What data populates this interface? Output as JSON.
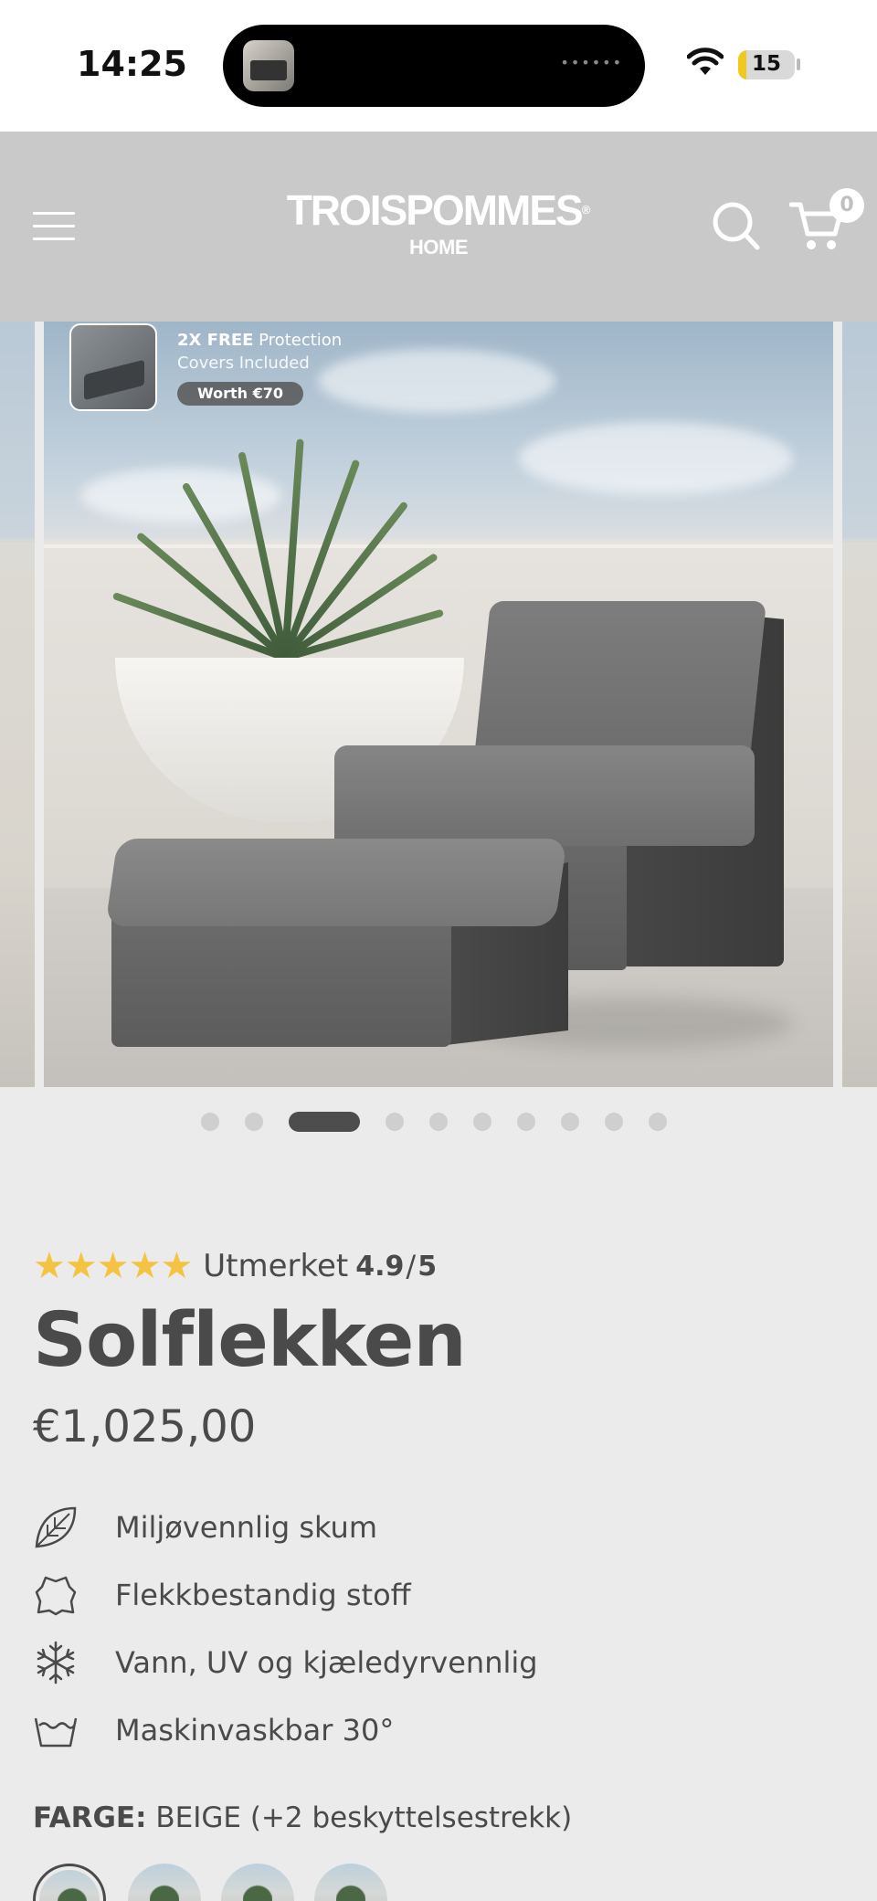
{
  "status_bar": {
    "time": "14:25",
    "battery": "15",
    "battery_fraction": 0.15,
    "battery_color": "#f2c81e"
  },
  "header": {
    "logo_main": "TROISPOMMES",
    "logo_registered": "®",
    "logo_sub": "HOME",
    "cart_count": "0",
    "icons": [
      "menu-icon",
      "search-icon",
      "cart-icon"
    ]
  },
  "carousel": {
    "promo_bold": "2X FREE",
    "promo_rest": " Protection",
    "promo_line2": "Covers Included",
    "promo_worth": "Worth €70",
    "slide_count": 10,
    "active_index": 2
  },
  "product": {
    "rating_label": "Utmerket",
    "rating_value": "4.9",
    "rating_separator": "/",
    "rating_max": "5",
    "stars": "★★★★★",
    "star_color": "#f5c342",
    "title": "Solflekken",
    "price": "€1,025,00",
    "features": [
      {
        "icon": "leaf-icon",
        "label": "Miljøvennlig skum"
      },
      {
        "icon": "fabric-icon",
        "label": "Flekkbestandig stoff"
      },
      {
        "icon": "snowflake-icon",
        "label": "Vann, UV og kjæledyrvennlig"
      },
      {
        "icon": "wash-icon",
        "label": "Maskinvaskbar 30°"
      }
    ],
    "color_label": "FARGE:",
    "color_value": "BEIGE (+2 beskyttelsestrekk)"
  },
  "colors": {
    "background": "#ebebeb",
    "header": "#c9c9c9",
    "text": "#4a4a4a"
  }
}
